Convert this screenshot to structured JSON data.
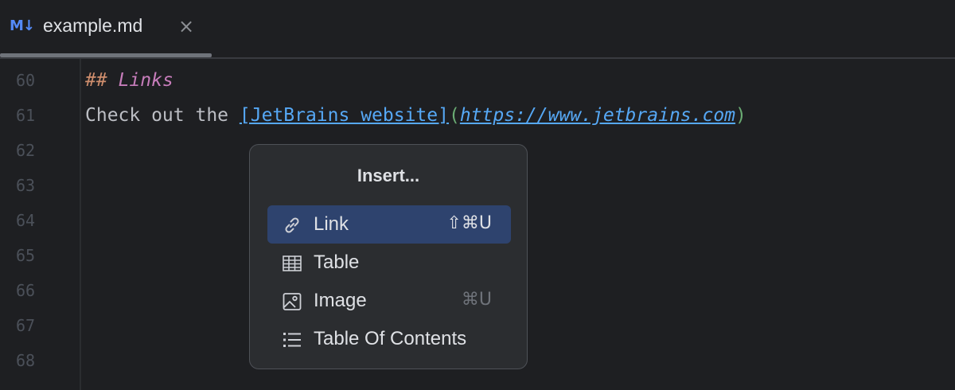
{
  "tab": {
    "icon": "M↓",
    "icon_name": "markdown-icon",
    "title": "example.md",
    "close": "×"
  },
  "editor": {
    "line_numbers": [
      "60",
      "61",
      "62",
      "63",
      "64",
      "65",
      "66",
      "67",
      "68"
    ],
    "line60": {
      "hash": "##",
      "text": "Links"
    },
    "line61": {
      "prefix": "Check out the ",
      "link_text": "[JetBrains website]",
      "open_paren": "(",
      "url": "https://www.jetbrains.com",
      "close_paren": ")"
    }
  },
  "popup": {
    "title": "Insert...",
    "items": [
      {
        "label": "Link",
        "shortcut": "⇧⌘U",
        "icon": "link-icon",
        "selected": true
      },
      {
        "label": "Table",
        "shortcut": "",
        "icon": "table-icon",
        "selected": false
      },
      {
        "label": "Image",
        "shortcut": "⌘U",
        "icon": "image-icon",
        "selected": false
      },
      {
        "label": "Table Of Contents",
        "shortcut": "",
        "icon": "list-icon",
        "selected": false
      }
    ]
  },
  "colors": {
    "background": "#1e1f22",
    "popup_bg": "#2b2d30",
    "selection": "#2e436e",
    "link": "#56a8f5",
    "header": "#c77dbb",
    "hash": "#cf8e6d",
    "paren": "#6aab73"
  }
}
